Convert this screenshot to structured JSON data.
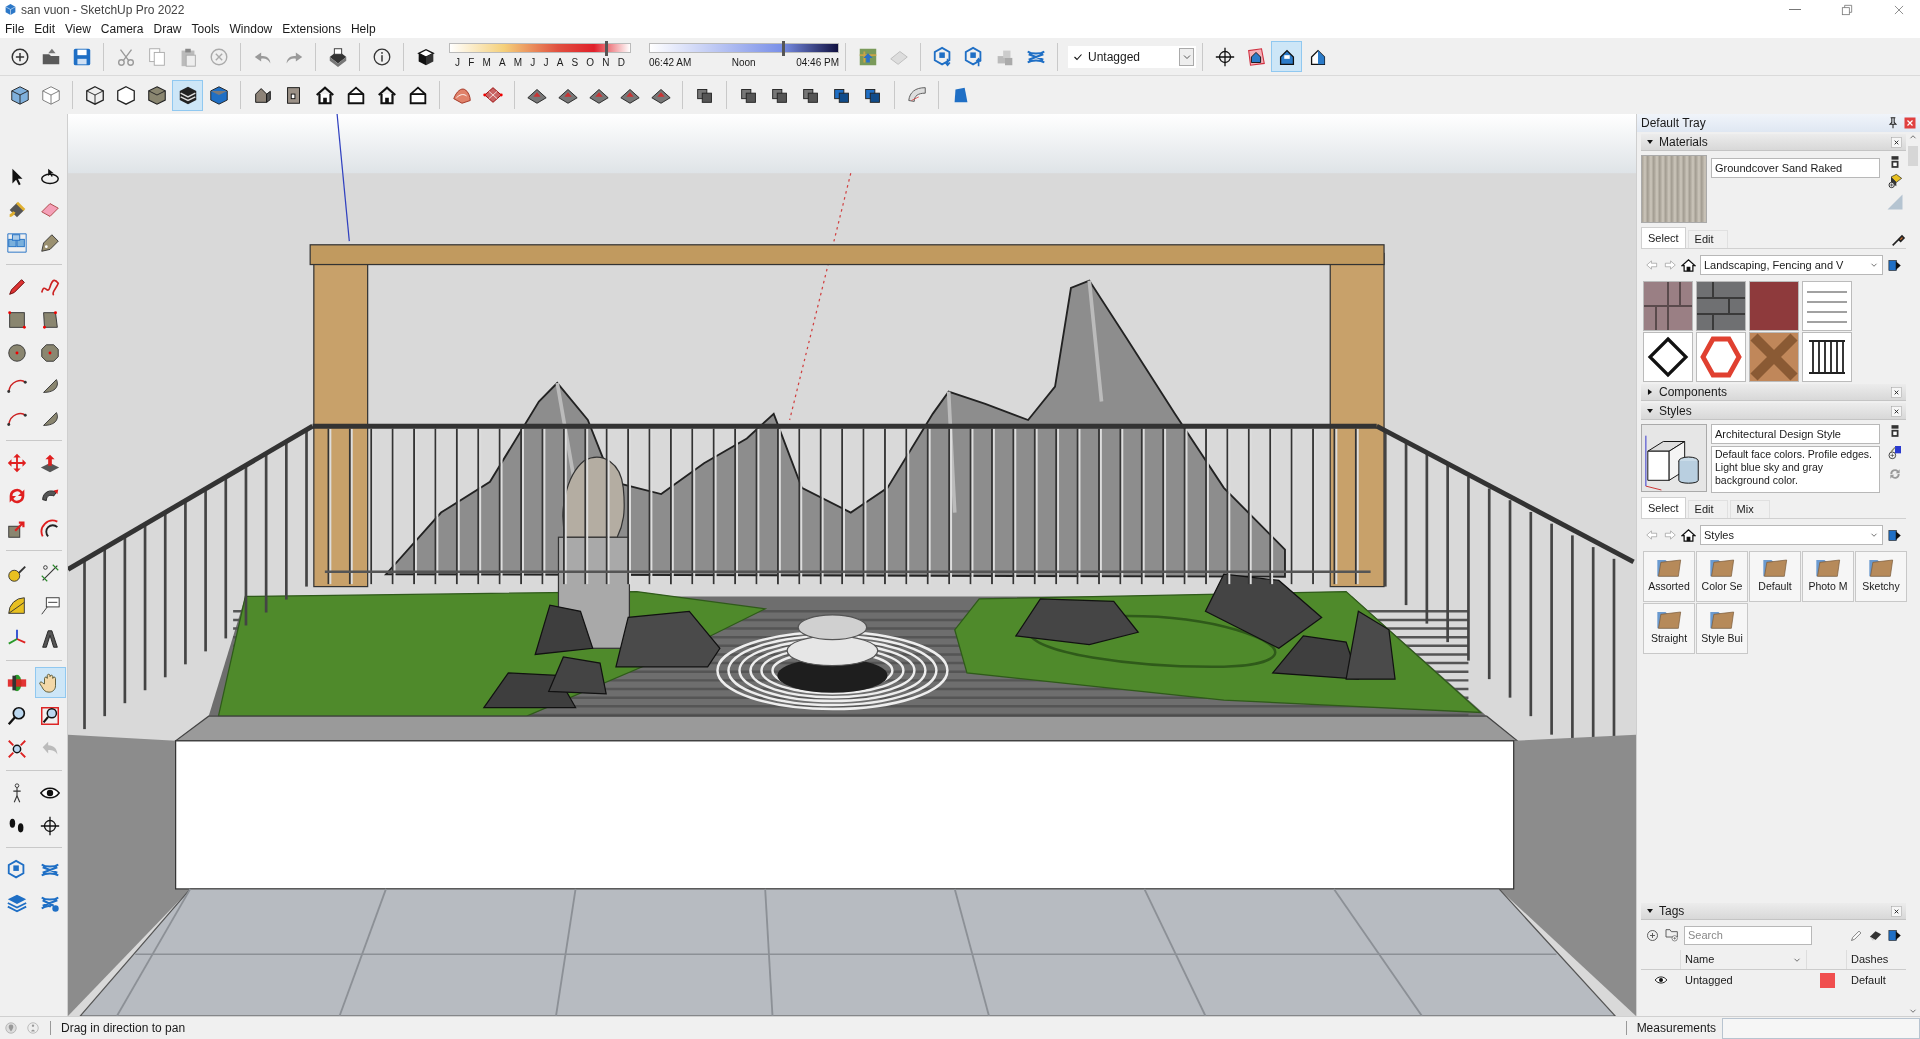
{
  "window": {
    "title": "san vuon - SketchUp Pro 2022"
  },
  "menu": [
    "File",
    "Edit",
    "View",
    "Camera",
    "Draw",
    "Tools",
    "Window",
    "Extensions",
    "Help"
  ],
  "main_toolbar": {
    "buttons": [
      {
        "selected": false
      },
      {
        "selected": false
      },
      {
        "selected": false
      },
      {
        "selected": false
      },
      {
        "selected": false
      },
      {
        "selected": false
      },
      {
        "selected": false
      },
      {
        "selected": false
      },
      {
        "selected": false
      },
      {
        "selected": false
      },
      {
        "selected": false
      },
      {
        "selected": false
      },
      {
        "selected": false
      },
      {
        "selected": false
      },
      {
        "selected": false
      },
      {
        "selected": false
      },
      {
        "selected": false
      },
      {
        "selected": false
      },
      {
        "selected": false
      },
      {
        "selected": false
      },
      {
        "selected": true
      },
      {
        "selected": false
      }
    ]
  },
  "shadow_settings": {
    "months": [
      "J",
      "F",
      "M",
      "A",
      "M",
      "J",
      "J",
      "A",
      "S",
      "O",
      "N",
      "D"
    ],
    "month_slider": {
      "level": 0.86
    },
    "time_labels": [
      "06:42 AM",
      "Noon",
      "04:46 PM"
    ],
    "time_slider": {
      "level": 0.7
    }
  },
  "tag_dropdown": {
    "checked": true,
    "value": "Untagged"
  },
  "views_toolbar": {
    "buttons": [
      {
        "selected": false
      },
      {
        "selected": false
      },
      {
        "selected": false
      },
      {
        "selected": false
      },
      {
        "selected": false
      },
      {
        "selected": true
      },
      {
        "selected": false
      },
      {
        "selected": false
      },
      {
        "selected": false
      },
      {
        "selected": false
      },
      {
        "selected": false
      },
      {
        "selected": false
      },
      {
        "selected": false
      },
      {
        "selected": false
      },
      {
        "selected": false
      },
      {
        "selected": false
      },
      {
        "selected": false
      },
      {
        "selected": false
      },
      {
        "selected": false
      },
      {
        "selected": false
      },
      {
        "selected": false
      },
      {
        "selected": false
      },
      {
        "selected": false
      },
      {
        "selected": false
      },
      {
        "selected": false
      },
      {
        "selected": false
      },
      {
        "selected": false
      },
      {
        "selected": false
      }
    ]
  },
  "tool_palette": {
    "buttons": [
      {
        "selected": false
      },
      {
        "selected": false
      },
      {
        "selected": false
      },
      {
        "selected": false
      },
      {
        "selected": false
      },
      {
        "selected": false
      },
      {
        "selected": false
      },
      {
        "selected": false
      },
      {
        "selected": false
      },
      {
        "selected": false
      },
      {
        "selected": false
      },
      {
        "selected": false
      },
      {
        "selected": false
      },
      {
        "selected": false
      },
      {
        "selected": false
      },
      {
        "selected": false
      },
      {
        "selected": false
      },
      {
        "selected": false
      },
      {
        "selected": false
      },
      {
        "selected": false
      },
      {
        "selected": false
      },
      {
        "selected": false
      },
      {
        "selected": false
      },
      {
        "selected": false
      },
      {
        "selected": false
      },
      {
        "selected": false
      },
      {
        "selected": false
      },
      {
        "selected": false
      },
      {
        "selected": false
      },
      {
        "selected": true
      },
      {
        "selected": false
      },
      {
        "selected": false
      },
      {
        "selected": false
      },
      {
        "selected": false
      },
      {
        "selected": false
      },
      {
        "selected": false
      },
      {
        "selected": false
      },
      {
        "selected": false
      },
      {
        "selected": false
      },
      {
        "selected": false
      },
      {
        "selected": false
      },
      {
        "selected": false
      }
    ]
  },
  "tray": {
    "title": "Default Tray",
    "materials": {
      "label": "Materials",
      "expanded": true,
      "name": "Groundcover Sand Raked",
      "tabs": [
        {
          "label": "Select",
          "selected": true
        },
        {
          "label": "Edit",
          "selected": false
        }
      ],
      "library": "Landscaping, Fencing and V"
    },
    "components": {
      "label": "Components",
      "expanded": false
    },
    "styles": {
      "label": "Styles",
      "expanded": true,
      "name": "Architectural Design Style",
      "description": "Default face colors. Profile edges. Light blue sky and gray background color.",
      "tabs": [
        {
          "label": "Select",
          "selected": true
        },
        {
          "label": "Edit",
          "selected": false
        },
        {
          "label": "Mix",
          "selected": false
        }
      ],
      "library": "Styles",
      "folders": [
        "Assorted",
        "Color Se",
        "Default",
        "Photo M",
        "Sketchy",
        "Straight",
        "Style Bui"
      ]
    },
    "tags": {
      "label": "Tags",
      "expanded": true,
      "search_placeholder": "Search",
      "columns": [
        "Name",
        "Dashes"
      ],
      "rows": [
        {
          "name": "Untagged",
          "visible": true,
          "color": "#f04e4e",
          "dashes": "Default"
        }
      ]
    }
  },
  "status_bar": {
    "message": "Drag in direction to pan",
    "measurements_label": "Measurements"
  }
}
